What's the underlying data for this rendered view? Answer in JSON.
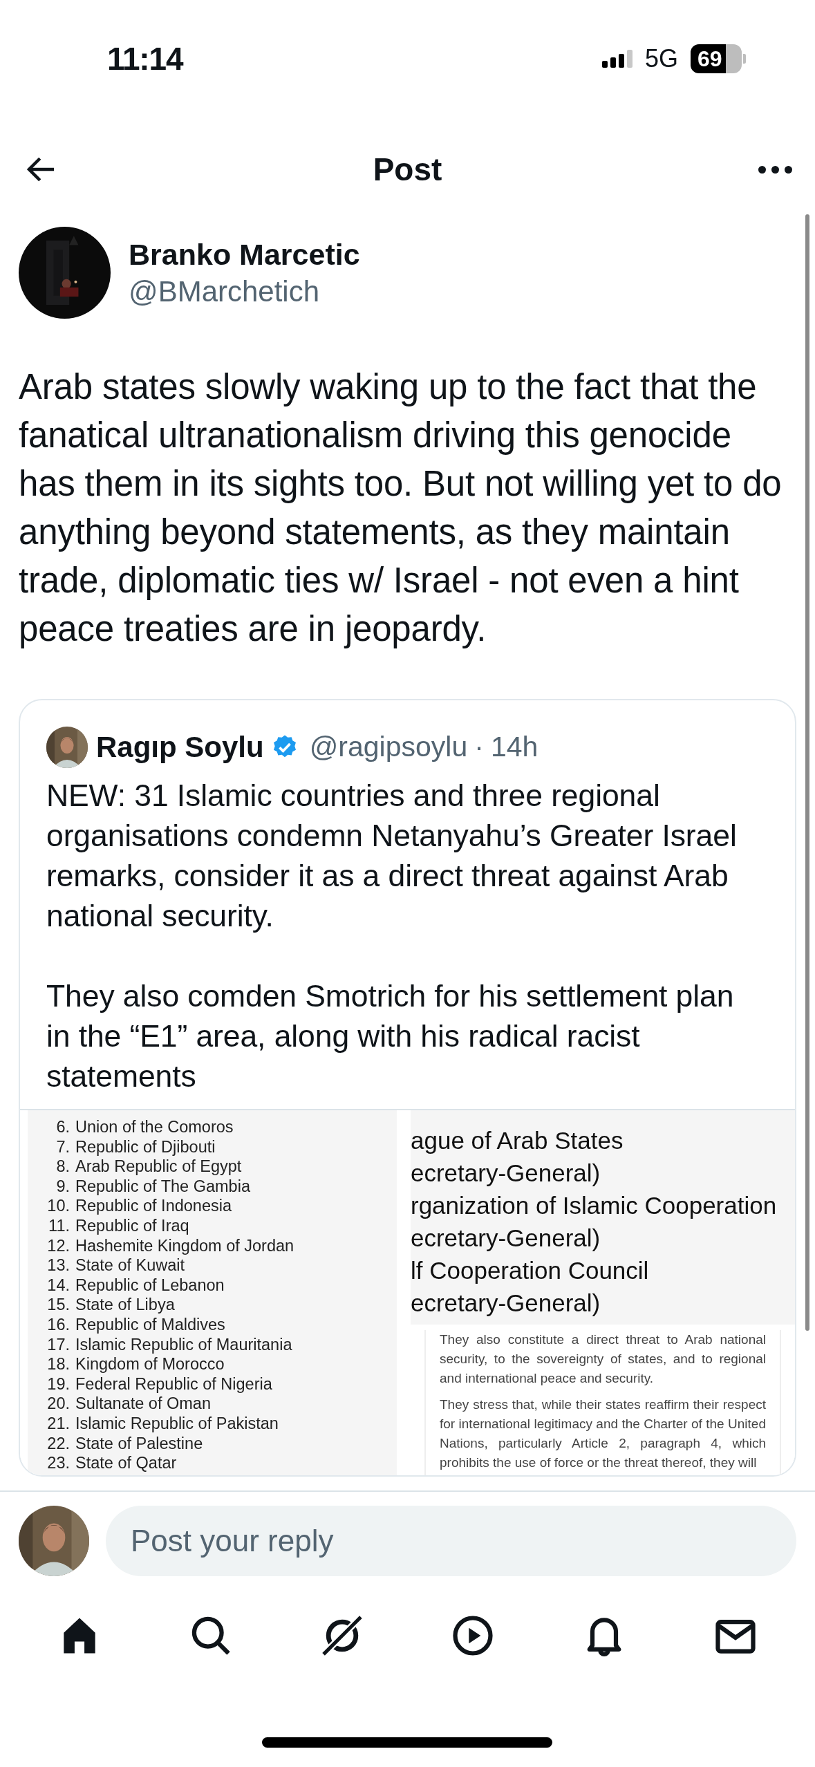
{
  "status_bar": {
    "time": "11:14",
    "network": "5G",
    "battery": "69"
  },
  "header": {
    "title": "Post"
  },
  "post": {
    "author": "Branko Marcetic",
    "handle": "@BMarchetich",
    "text": "Arab states slowly waking up to the fact that the fanatical ultranationalism driving this genocide has them in its sights too. But not willing yet to do anything beyond statements, as they maintain trade, diplomatic ties w/ Israel - not even a hint peace treaties are in jeopardy."
  },
  "quote": {
    "author": "Ragıp Soylu",
    "verified": true,
    "handle": "@ragipsoylu",
    "separator": "·",
    "time": "14h",
    "paragraphs": [
      "NEW: 31 Islamic countries and three regional organisations condemn Netanyahu’s Greater Israel remarks, consider it as a direct threat against Arab national security.",
      "They also comden Smotrich for his settlement plan in the “E1” area, along with his radical racist statements"
    ],
    "document_left": {
      "items": [
        {
          "number": "6.",
          "name": "Union of the Comoros"
        },
        {
          "number": "7.",
          "name": "Republic of Djibouti"
        },
        {
          "number": "8.",
          "name": "Arab Republic of Egypt"
        },
        {
          "number": "9.",
          "name": "Republic of The Gambia"
        },
        {
          "number": "10.",
          "name": "Republic of Indonesia"
        },
        {
          "number": "11.",
          "name": "Republic of Iraq"
        },
        {
          "number": "12.",
          "name": "Hashemite Kingdom of Jordan"
        },
        {
          "number": "13.",
          "name": "State of Kuwait"
        },
        {
          "number": "14.",
          "name": "Republic of Lebanon"
        },
        {
          "number": "15.",
          "name": "State of Libya"
        },
        {
          "number": "16.",
          "name": "Republic of Maldives"
        },
        {
          "number": "17.",
          "name": "Islamic Republic of Mauritania"
        },
        {
          "number": "18.",
          "name": "Kingdom of Morocco"
        },
        {
          "number": "19.",
          "name": "Federal Republic of Nigeria"
        },
        {
          "number": "20.",
          "name": "Sultanate of Oman"
        },
        {
          "number": "21.",
          "name": "Islamic Republic of Pakistan"
        },
        {
          "number": "22.",
          "name": "State of Palestine"
        },
        {
          "number": "23.",
          "name": "State of Qatar"
        }
      ]
    },
    "document_right_top": {
      "lines": [
        "ague of Arab States",
        "ecretary-General)",
        "rganization of Islamic Cooperation",
        "ecretary-General)",
        "lf Cooperation Council",
        "ecretary-General)"
      ]
    },
    "document_right_bottom": {
      "paragraphs": [
        "They also constitute a direct threat to Arab national security, to the sovereignty of states, and to regional and international peace and security.",
        "They stress that, while their states reaffirm their respect for international legitimacy and the Charter of the United Nations, particularly Article 2, paragraph 4, which prohibits the use of force or the threat thereof, they will"
      ]
    }
  },
  "reply": {
    "placeholder": "Post your reply"
  },
  "tab_bar": [
    {
      "kind": "home",
      "selected": true
    },
    {
      "kind": "search",
      "selected": false
    },
    {
      "kind": "grok",
      "selected": false
    },
    {
      "kind": "video",
      "selected": false
    },
    {
      "kind": "notifications",
      "selected": false
    },
    {
      "kind": "messages",
      "selected": false
    }
  ]
}
